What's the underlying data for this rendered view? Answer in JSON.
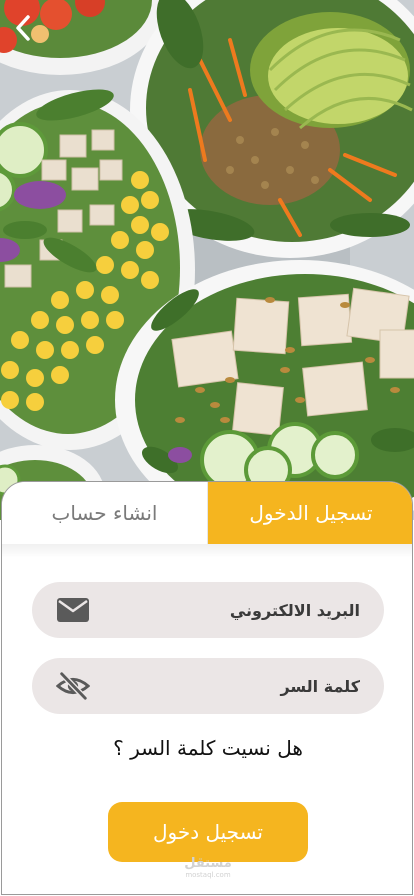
{
  "tabs": {
    "login_label": "تسجيل الدخول",
    "register_label": "انشاء حساب",
    "active": "login"
  },
  "form": {
    "email_placeholder": "البريد الالكتروني",
    "password_placeholder": "كلمة السر",
    "email_icon": "envelope-icon",
    "password_icon": "eye-slash-icon"
  },
  "forgot_password_label": "هل نسيت كلمة السر ؟",
  "submit_label": "تسجيل دخول",
  "watermark": {
    "arabic": "مستقل",
    "latin": "mostaql.com"
  },
  "colors": {
    "accent": "#f5b51f",
    "field_bg": "#ebe6e6",
    "tab_inactive_text": "#7a7a7a"
  }
}
